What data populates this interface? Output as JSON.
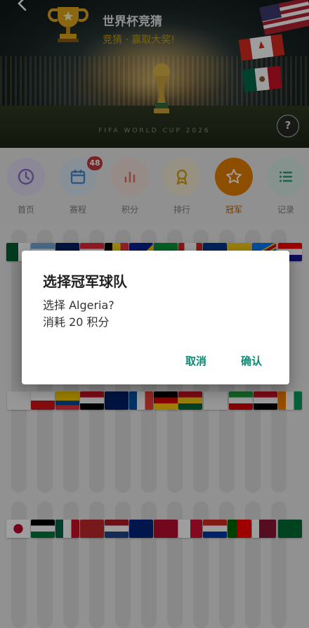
{
  "header": {
    "title": "世界杯竞猜",
    "subtitle": "竞猜 · 赢取大奖!",
    "banner_caption": "FIFA WORLD CUP 2026",
    "help_label": "?"
  },
  "nav": {
    "items": [
      {
        "label": "首页",
        "icon": "clock-icon",
        "color": "#8a6fc8"
      },
      {
        "label": "赛程",
        "icon": "calendar-icon",
        "color": "#4a8fd6",
        "badge": "48"
      },
      {
        "label": "积分",
        "icon": "bar-chart-icon",
        "color": "#e07a5f"
      },
      {
        "label": "排行",
        "icon": "medal-icon",
        "color": "#d4a017"
      },
      {
        "label": "冠军",
        "icon": "star-icon",
        "color": "#e67e00",
        "active": true
      },
      {
        "label": "记录",
        "icon": "list-icon",
        "color": "#2e9a7a"
      }
    ]
  },
  "dialog": {
    "title": "选择冠军球队",
    "message": "选择 Algeria?\n消耗 20 积分",
    "cancel_label": "取消",
    "confirm_label": "确认"
  },
  "colors": {
    "accent": "#0b8a73",
    "active_tab": "#e67e00",
    "badge": "#d94141"
  }
}
